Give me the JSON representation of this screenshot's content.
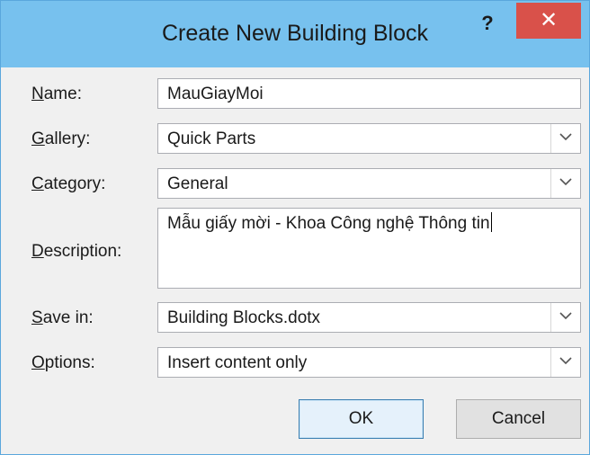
{
  "window": {
    "title": "Create New Building Block",
    "help_label": "?",
    "close_label": "✕"
  },
  "form": {
    "name": {
      "label_access": "N",
      "label_rest": "ame:",
      "value": "MauGiayMoi"
    },
    "gallery": {
      "label_access": "G",
      "label_rest": "allery:",
      "value": "Quick Parts"
    },
    "category": {
      "label_access": "C",
      "label_rest": "ategory:",
      "value": "General"
    },
    "description": {
      "label_access": "D",
      "label_rest": "escription:",
      "value": "Mẫu giấy mời - Khoa Công nghệ Thông tin"
    },
    "save_in": {
      "label_access": "S",
      "label_rest": "ave in:",
      "value": "Building Blocks.dotx"
    },
    "options": {
      "label_access": "O",
      "label_rest": "ptions:",
      "value": "Insert content only"
    }
  },
  "buttons": {
    "ok": "OK",
    "cancel": "Cancel"
  },
  "colors": {
    "titlebar": "#77c1ee",
    "close_button": "#d9514a",
    "dialog_body": "#f0f0f0"
  }
}
